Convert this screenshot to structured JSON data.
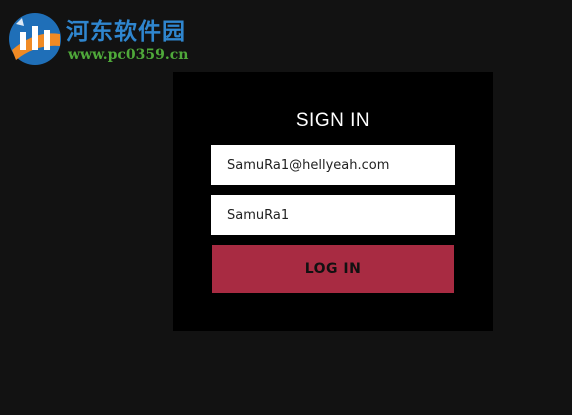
{
  "watermark": {
    "title": "河东软件园",
    "url": "www.pc0359.cn"
  },
  "signin": {
    "title": "SIGN IN",
    "email_value": "SamuRa1@hellyeah.com",
    "password_value": "SamuRa1",
    "login_label": "LOG IN"
  },
  "colors": {
    "background": "#121212",
    "panel": "#000000",
    "login_button": "#a82b42",
    "watermark_blue": "#2f86cf",
    "watermark_green": "#4fa93a"
  },
  "icons": {
    "watermark_logo": "site-logo-icon"
  }
}
